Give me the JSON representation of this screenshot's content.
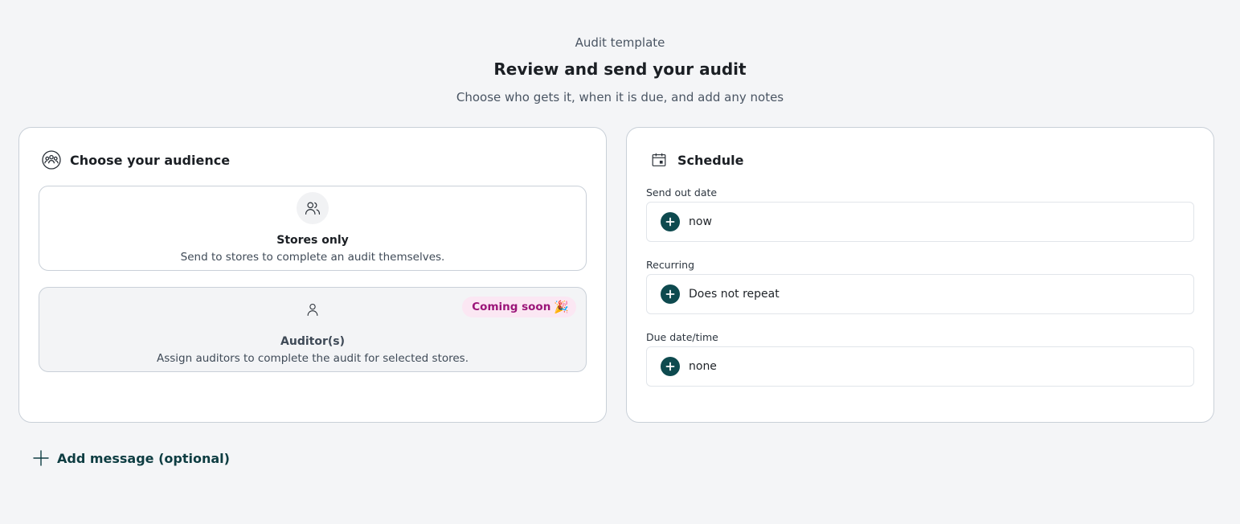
{
  "header": {
    "eyebrow": "Audit template",
    "title": "Review and send your audit",
    "subtitle": "Choose who gets it, when it is due, and add any notes"
  },
  "audience": {
    "title": "Choose your audience",
    "icon": "group-icon",
    "options": [
      {
        "title": "Stores only",
        "description": "Send to stores to complete an audit themselves.",
        "icon": "users-icon"
      },
      {
        "title": "Auditor(s)",
        "description": "Assign auditors to complete the audit for selected stores.",
        "icon": "user-icon",
        "badge": "Coming soon",
        "badge_emoji": "🎉"
      }
    ]
  },
  "schedule": {
    "title": "Schedule",
    "icon": "calendar-icon",
    "fields": [
      {
        "label": "Send out date",
        "value": "now"
      },
      {
        "label": "Recurring",
        "value": "Does not repeat"
      },
      {
        "label": "Due date/time",
        "value": "none"
      }
    ]
  },
  "add_message": {
    "label": "Add message (optional)",
    "icon": "plus-icon"
  },
  "colors": {
    "accent": "#0e4a4f",
    "badge_bg": "#fbe7f3",
    "badge_text": "#9b1579",
    "background": "#f4f5f7"
  }
}
